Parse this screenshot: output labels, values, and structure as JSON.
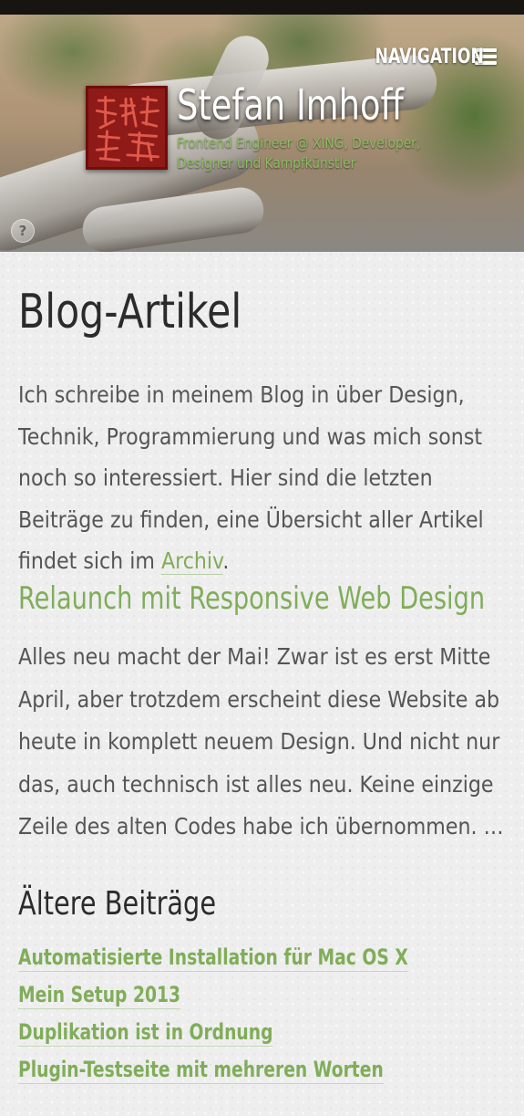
{
  "header": {
    "nav_label": "NAVIGATION",
    "site_title": "Stefan Imhoff",
    "tagline": "Frontend Engineer @ XING, Developer, Designer und Kampfkünstler",
    "help_glyph": "?",
    "icons": {
      "menu": "hamburger-menu-icon",
      "help": "question-mark-icon",
      "logo": "red-seal-logo"
    }
  },
  "main": {
    "page_title": "Blog-Artikel",
    "intro_text": "Ich schreibe in meinem Blog in über Design, Technik, Programmierung und was mich sonst noch so interessiert. Hier sind die letzten Beiträge zu finden, eine Übersicht aller Artikel findet sich im ",
    "archive_link": "Archiv",
    "intro_end": ".",
    "post": {
      "title": "Relaunch mit Responsive Web Design",
      "excerpt": "Alles neu macht der Mai! Zwar ist es erst Mitte April, aber trotzdem erscheint diese Website ab heute in komplett neuem Design. Und nicht nur das, auch technisch ist alles neu. Keine einzige Zeile des alten Codes habe ich übernommen. …"
    },
    "older": {
      "heading": "Ältere Beiträge",
      "items": [
        "Automatisierte Installation für Mac OS X",
        "Mein Setup 2013",
        "Duplikation ist in Ordnung",
        "Plugin-Testseite mit mehreren Worten"
      ]
    }
  },
  "colors": {
    "accent": "#80ad59",
    "text": "#555555",
    "heading": "#2b2b2b",
    "top_bar": "#171412",
    "logo_red": "#8e1b17"
  }
}
